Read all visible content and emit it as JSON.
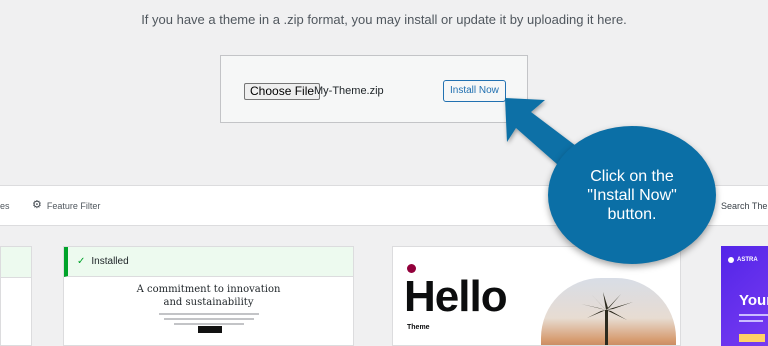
{
  "upload": {
    "hint": "If you have a theme in a .zip format, you may install or update it by uploading it here.",
    "choose_file_label": "Choose File",
    "file_name": "My-Theme.zip",
    "install_label": "Install Now"
  },
  "filters": {
    "partial_tab": "es",
    "feature_filter_label": "Feature Filter",
    "search_label": "Search The"
  },
  "themes": {
    "installed_label": "Installed",
    "card_commitment_title": "A commitment to innovation\nand sustainability",
    "hello_title": "Hello",
    "hello_subtitle": "Theme",
    "astra_brand": "ASTRA",
    "astra_heading": "Your"
  },
  "callout": {
    "text": "Click on the \"Install Now\" button.",
    "color": "#0b6fa6"
  },
  "icons": {
    "feature_filter": "gear-icon",
    "installed": "check-icon",
    "elementor": "elementor-icon"
  }
}
